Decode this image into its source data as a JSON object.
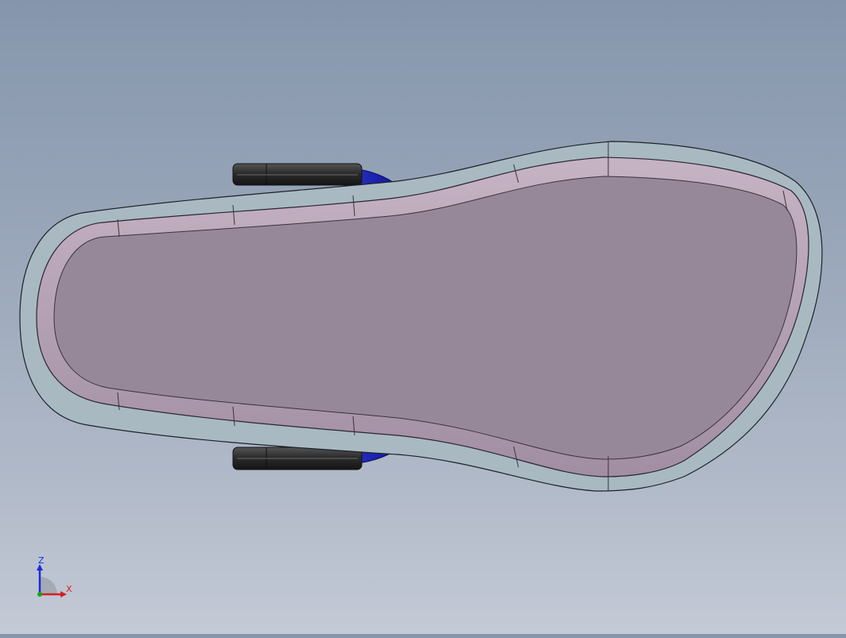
{
  "viewport": {
    "model": "sandal-sole-assembly",
    "view": "bottom",
    "colors": {
      "background_top": "#8596ac",
      "background_bottom": "#c4cad6",
      "outsole": "#a8b9c2",
      "insole_rim": "#b39eb1",
      "footbed": "#968899",
      "strap_pad": "#2a2a2a",
      "strap_band": "#1a1ea8"
    }
  },
  "triad": {
    "z_label": "Z",
    "x_label": "X",
    "colors": {
      "z": "#1b2bd6",
      "x": "#d22020",
      "y": "#1aa01a"
    }
  }
}
